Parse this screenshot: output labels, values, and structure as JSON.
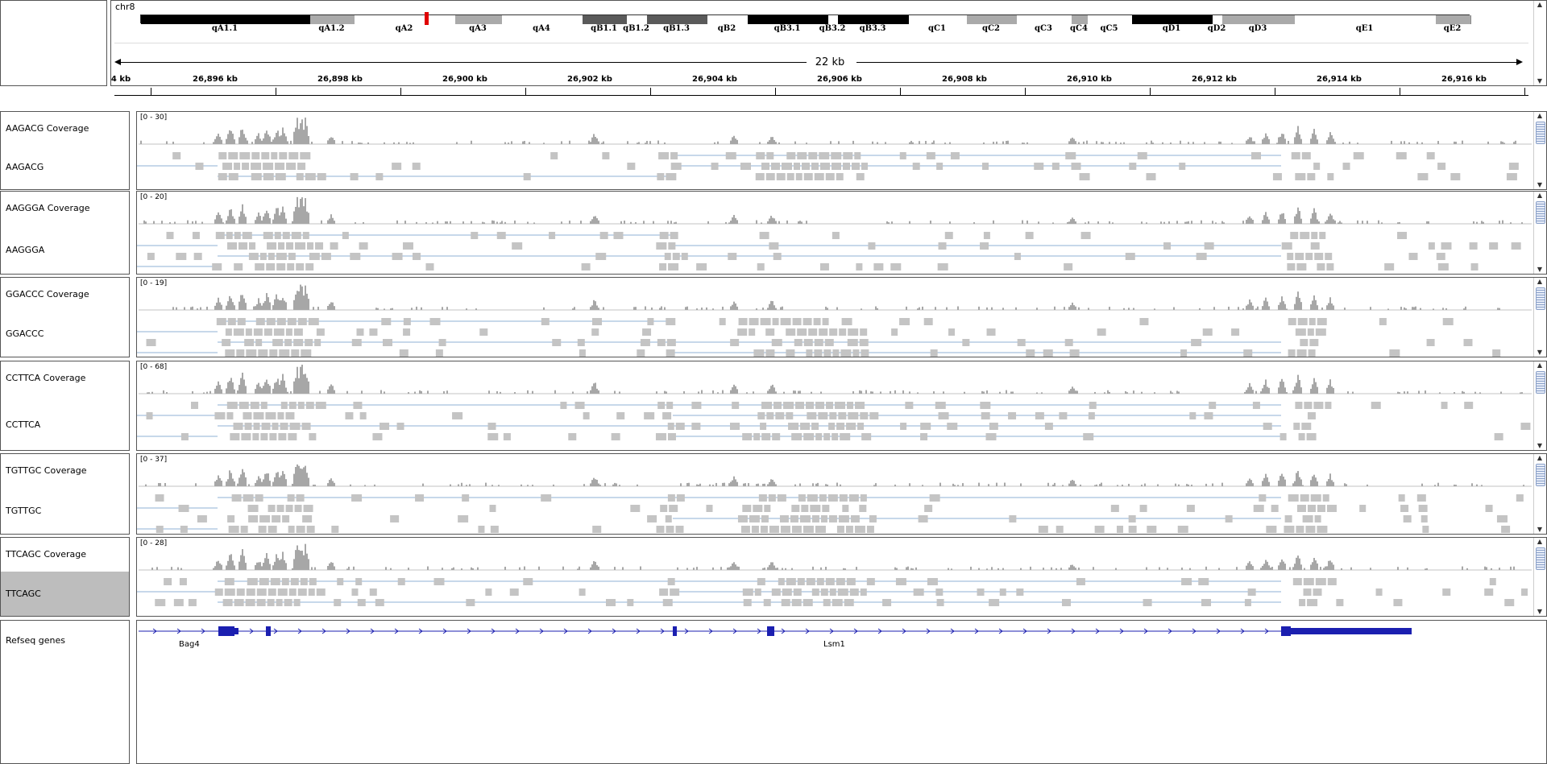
{
  "colors": {
    "coverage": "#a7a7a7",
    "read": "#c4c4c4",
    "spliced_line": "#8fb0d4",
    "gene": "#1b1fb0",
    "panel_border": "#555555",
    "selected_track": "#bdbdbd"
  },
  "header": {
    "chromosome": "chr8",
    "span_label": "22 kb",
    "cytobands": [
      {
        "name": "qA1.1",
        "stain": "black"
      },
      {
        "name": "qA1.2",
        "stain": "grey"
      },
      {
        "name": "qA2",
        "stain": "white"
      },
      {
        "name": "qA3",
        "stain": "grey"
      },
      {
        "name": "qA4",
        "stain": "white"
      },
      {
        "name": "qB1.1",
        "stain": "dark"
      },
      {
        "name": "qB1.2",
        "stain": "white"
      },
      {
        "name": "qB1.3",
        "stain": "dark"
      },
      {
        "name": "qB2",
        "stain": "white"
      },
      {
        "name": "qB3.1",
        "stain": "black"
      },
      {
        "name": "qB3.2",
        "stain": "white"
      },
      {
        "name": "qB3.3",
        "stain": "black"
      },
      {
        "name": "qC1",
        "stain": "white"
      },
      {
        "name": "qC2",
        "stain": "grey"
      },
      {
        "name": "qC3",
        "stain": "white"
      },
      {
        "name": "qC4",
        "stain": "grey"
      },
      {
        "name": "qC5",
        "stain": "white"
      },
      {
        "name": "qD1",
        "stain": "black"
      },
      {
        "name": "qD2",
        "stain": "white"
      },
      {
        "name": "qD3",
        "stain": "grey"
      },
      {
        "name": "qE1",
        "stain": "white"
      },
      {
        "name": "qE2",
        "stain": "grey"
      }
    ],
    "ruler_ticks": [
      "4 kb",
      "26,896 kb",
      "26,898 kb",
      "26,900 kb",
      "26,902 kb",
      "26,904 kb",
      "26,906 kb",
      "26,908 kb",
      "26,910 kb",
      "26,912 kb",
      "26,914 kb",
      "26,916 kb"
    ]
  },
  "tracks": [
    {
      "sample": "AAGACG",
      "coverage_label": "AAGACG Coverage",
      "reads_label": "AAGACG",
      "range": "[0 - 30]"
    },
    {
      "sample": "AAGGGA",
      "coverage_label": "AAGGGA Coverage",
      "reads_label": "AAGGGA",
      "range": "[0 - 20]"
    },
    {
      "sample": "GGACCC",
      "coverage_label": "GGACCC Coverage",
      "reads_label": "GGACCC",
      "range": "[0 - 19]"
    },
    {
      "sample": "CCTTCA",
      "coverage_label": "CCTTCA Coverage",
      "reads_label": "CCTTCA",
      "range": "[0 - 68]"
    },
    {
      "sample": "TGTTGC",
      "coverage_label": "TGTTGC Coverage",
      "reads_label": "TGTTGC",
      "range": "[0 - 37]"
    },
    {
      "sample": "TTCAGC",
      "coverage_label": "TTCAGC Coverage",
      "reads_label": "TTCAGC",
      "range": "[0 - 28]"
    }
  ],
  "genes_track": {
    "label": "Refseq genes",
    "genes": [
      "Bag4",
      "Lsm1"
    ]
  }
}
